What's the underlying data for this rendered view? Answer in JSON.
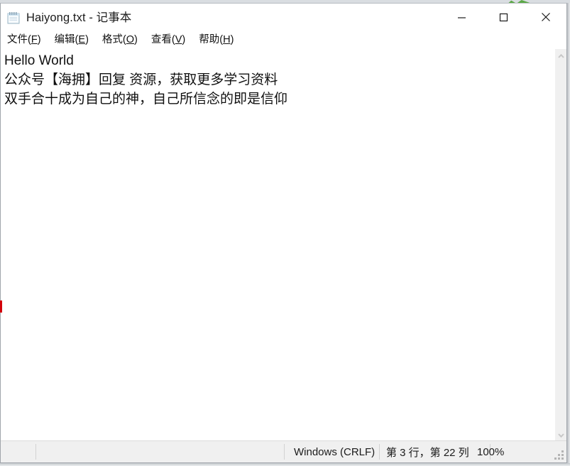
{
  "window": {
    "title": "Haiyong.txt - 记事本",
    "icon": "notepad-icon",
    "controls": {
      "minimize": "—",
      "maximize": "□",
      "close": "✕"
    }
  },
  "menubar": {
    "items": [
      {
        "label": "文件",
        "accel": "F",
        "pre": "文件(",
        "post": ")"
      },
      {
        "label": "编辑",
        "accel": "E",
        "pre": "编辑(",
        "post": ")"
      },
      {
        "label": "格式",
        "accel": "O",
        "pre": "格式(",
        "post": ")"
      },
      {
        "label": "查看",
        "accel": "V",
        "pre": "查看(",
        "post": ")"
      },
      {
        "label": "帮助",
        "accel": "H",
        "pre": "帮助(",
        "post": ")"
      }
    ]
  },
  "document": {
    "lines": [
      "Hello World",
      "公众号【海拥】回复 资源，获取更多学习资料",
      "双手合十成为自己的神，自己所信念的即是信仰"
    ]
  },
  "scrollbar": {
    "up_arrow": "scroll-up-icon",
    "down_arrow": "scroll-down-icon"
  },
  "statusbar": {
    "line_ending": "Windows (CRLF)",
    "cursor_position": "第 3 行，第 22 列",
    "zoom": "100%"
  },
  "colors": {
    "window_bg": "#ffffff",
    "statusbar_bg": "#f0f0f0",
    "border": "#a0a5ab",
    "text": "#101010",
    "red_marker": "#d3000a",
    "desktop_green": "#5aa845"
  }
}
